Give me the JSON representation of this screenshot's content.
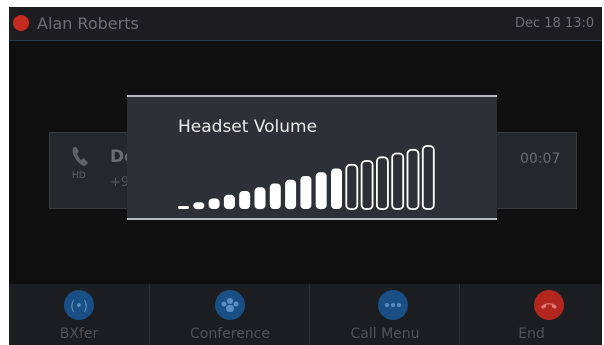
{
  "status_bar": {
    "contact_name": "Alan Roberts",
    "datetime": "Dec 18 13:0"
  },
  "call": {
    "name": "De",
    "number": "+9",
    "timer": "00:07",
    "hd_label": "HD"
  },
  "popup": {
    "title": "Headset Volume",
    "level": 11,
    "max_level": 17
  },
  "softkeys": [
    {
      "label": "BXfer",
      "icon": "transfer-icon",
      "color": "#1a4f86"
    },
    {
      "label": "Conference",
      "icon": "conference-icon",
      "color": "#1a4f86"
    },
    {
      "label": "Call Menu",
      "icon": "more-icon",
      "color": "#1a4f86"
    },
    {
      "label": "End",
      "icon": "end-call-icon",
      "color": "#b3261e"
    }
  ],
  "colors": {
    "status_dot": "#c62a1f",
    "accent_blue": "#1a4f86",
    "end_red": "#b3261e"
  }
}
